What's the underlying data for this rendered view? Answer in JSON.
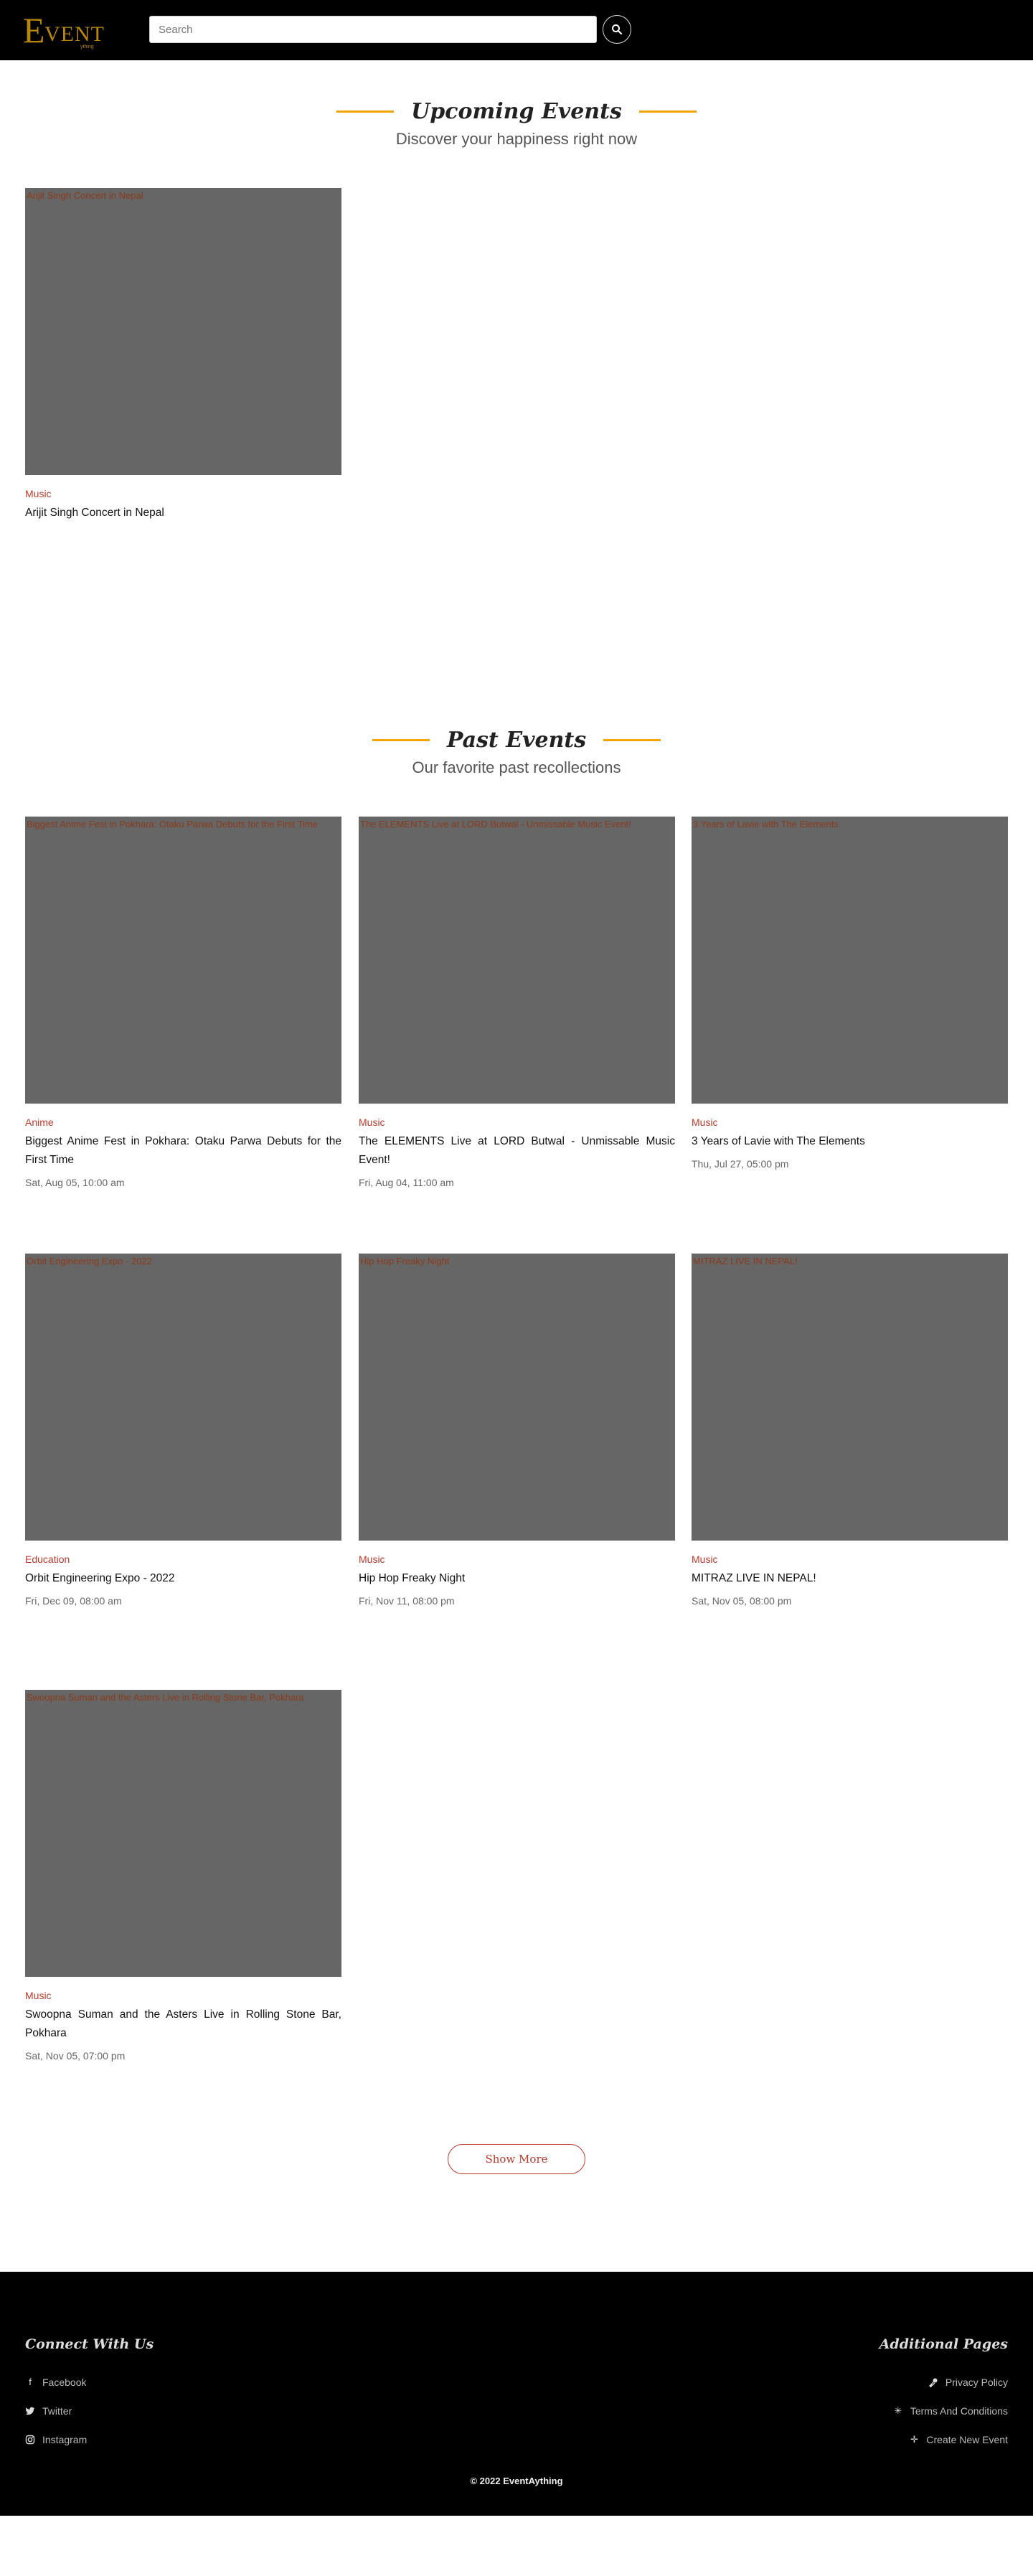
{
  "header": {
    "logo_big": "E",
    "logo_rest": "VENT",
    "logo_tag": "ything",
    "search_placeholder": "Search"
  },
  "upcoming": {
    "title": "Upcoming Events",
    "subtitle": "Discover your happiness right now",
    "events": [
      {
        "alt": "Arijit Singh Concert in Nepal",
        "category": "Music",
        "title": "Arijit Singh Concert in Nepal",
        "date": ""
      }
    ]
  },
  "past": {
    "title": "Past Events",
    "subtitle": "Our favorite past recollections",
    "events": [
      {
        "alt": "Biggest Anime Fest in Pokhara: Otaku Parwa Debuts for the First Time",
        "category": "Anime",
        "title": "Biggest Anime Fest in Pokhara: Otaku Parwa Debuts for the First Time",
        "date": "Sat, Aug 05, 10:00 am"
      },
      {
        "alt": "The ELEMENTS Live at LORD Butwal - Unmissable Music Event!",
        "category": "Music",
        "title": "The ELEMENTS Live at LORD Butwal - Unmissable Music Event!",
        "date": "Fri, Aug 04, 11:00 am"
      },
      {
        "alt": "3 Years of Lavie with The Elements",
        "category": "Music",
        "title": "3 Years of Lavie with The Elements",
        "date": "Thu, Jul 27, 05:00 pm"
      },
      {
        "alt": "Orbit Engineering Expo - 2022",
        "category": "Education",
        "title": "Orbit Engineering Expo - 2022",
        "date": "Fri, Dec 09, 08:00 am"
      },
      {
        "alt": "Hip Hop Freaky Night",
        "category": "Music",
        "title": "Hip Hop Freaky Night",
        "date": "Fri, Nov 11, 08:00 pm"
      },
      {
        "alt": "MITRAZ LIVE IN NEPAL!",
        "category": "Music",
        "title": "MITRAZ LIVE IN NEPAL!",
        "date": "Sat, Nov 05, 08:00 pm"
      },
      {
        "alt": "Swoopna Suman and the Asters Live in Rolling Stone Bar, Pokhara",
        "category": "Music",
        "title": "Swoopna Suman and the Asters Live in Rolling Stone Bar, Pokhara",
        "date": "Sat, Nov 05, 07:00 pm"
      }
    ],
    "show_more": "Show More"
  },
  "footer": {
    "connect_title": "Connect With Us",
    "connect_links": [
      "Facebook",
      "Twitter",
      "Instagram"
    ],
    "pages_title": "Additional Pages",
    "pages_links": [
      "Privacy Policy",
      "Terms And Conditions",
      "Create New Event"
    ],
    "copyright": "© 2022 EventAything"
  },
  "colors": {
    "accent_line": "#f4a300",
    "category": "#c0392b",
    "header_bg": "#000000",
    "logo": "#b8860b"
  },
  "icons": {
    "search": "search-icon",
    "facebook": "facebook-icon",
    "twitter": "twitter-icon",
    "instagram": "instagram-icon",
    "privacy": "key-icon",
    "terms": "asterisk-icon",
    "create": "plus-icon"
  }
}
